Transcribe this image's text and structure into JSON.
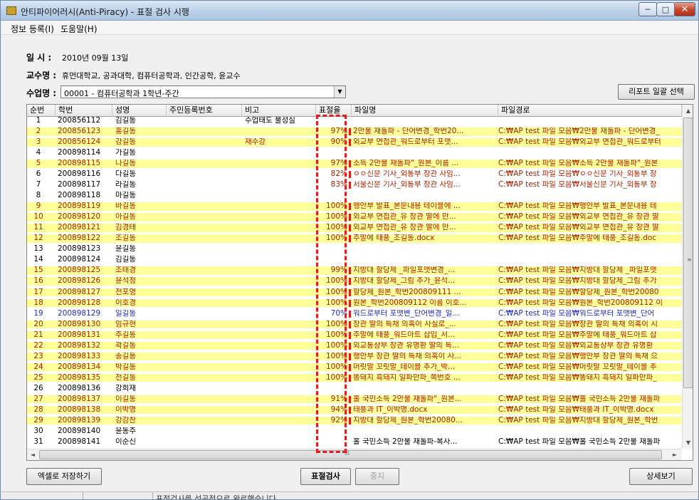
{
  "window": {
    "title": "안티파이어러시(Anti-Piracy) - 표절 검사 시행",
    "min": "─",
    "max": "□",
    "close": "✕"
  },
  "menu": [
    "정보 등록(I)",
    "도움말(H)"
  ],
  "info": {
    "date_label": "일  시 :",
    "date_value": "2010년 09월 13일",
    "prof_label": "교수명 :",
    "prof_value": "휴먼대학교, 공과대학, 컴퓨터공학과, 인간공학, 윤교수",
    "course_label": "수업명 :",
    "course_value": "00001 - 컴퓨터공학과 1학년-주간"
  },
  "buttons": {
    "report": "리포트 일괄 선택",
    "excel": "엑셀로 저장하기",
    "check": "표절검사",
    "stop": "중지",
    "detail": "상세보기"
  },
  "columns": [
    "순번",
    "학번",
    "성명",
    "주민등록번호",
    "비고",
    "표절율",
    "파일명",
    "파일경로"
  ],
  "rows": [
    {
      "no": "1",
      "id": "200856112",
      "name": "김길동",
      "note": "수업태도 불성실",
      "pct": "",
      "file": "",
      "path": "",
      "style": "normal"
    },
    {
      "no": "2",
      "id": "200856123",
      "name": "홍길동",
      "note": "",
      "pct": "97%",
      "file": "2만불 재돌파 - 단어변경_학번20...",
      "path": "C:₩AP test 파일 모음₩2만불 재돌파 - 단어변경_",
      "style": "hl"
    },
    {
      "no": "3",
      "id": "200856124",
      "name": "강길동",
      "note": "재수강",
      "pct": "90%",
      "file": "외교부 면접관_워드로부터 포맷...",
      "path": "C:₩AP test 파일 모음₩외교부 면접관_워드로부터",
      "style": "hl"
    },
    {
      "no": "4",
      "id": "200898114",
      "name": "가길동",
      "note": "",
      "pct": "",
      "file": "",
      "path": "",
      "style": "normal"
    },
    {
      "no": "5",
      "id": "200898115",
      "name": "나길동",
      "note": "",
      "pct": "97%",
      "file": "소득 2만불 재돌파\"_원본_이름 ...",
      "path": "C:₩AP test 파일 모음₩소득 2만불 재돌파\"_원본",
      "style": "hl"
    },
    {
      "no": "6",
      "id": "200898116",
      "name": "다길동",
      "note": "",
      "pct": "82%",
      "file": "ㅇㅇ신문 기사_외통부 장관 사임...",
      "path": "C:₩AP test 파일 모음₩ㅇㅇ신문 기사_외통부 장",
      "style": "normal-red"
    },
    {
      "no": "7",
      "id": "200898117",
      "name": "라길동",
      "note": "",
      "pct": "83%",
      "file": "서울신문 기사_외통부 장관 사임...",
      "path": "C:₩AP test 파일 모음₩서울신문 기사_외통부 장",
      "style": "normal-red"
    },
    {
      "no": "8",
      "id": "200898118",
      "name": "마길동",
      "note": "",
      "pct": "",
      "file": "",
      "path": "",
      "style": "normal"
    },
    {
      "no": "9",
      "id": "200898119",
      "name": "바길동",
      "note": "",
      "pct": "100%",
      "file": "행안부 발표_본문내용 테이블에 ...",
      "path": "C:₩AP test 파일 모음₩행안부 발표_본문내용 테",
      "style": "hl"
    },
    {
      "no": "10",
      "id": "200898120",
      "name": "아길동",
      "note": "",
      "pct": "100%",
      "file": "외교부 면접관_유 장관 딸에 만...",
      "path": "C:₩AP test 파일 모음₩외교부 면접관_유 장관 딸",
      "style": "hl"
    },
    {
      "no": "11",
      "id": "200898121",
      "name": "김경태",
      "note": "",
      "pct": "100%",
      "file": "외교부 면접관_유 장관 딸에 만...",
      "path": "C:₩AP test 파일 모음₩외교부 면접관_유 장관 딸",
      "style": "hl"
    },
    {
      "no": "12",
      "id": "200898122",
      "name": "조길동",
      "note": "",
      "pct": "100%",
      "file": "주말에 태풍_조길동.docx",
      "path": "C:₩AP test 파일 모음₩주말에 태풍_조길동.doc",
      "style": "hl"
    },
    {
      "no": "13",
      "id": "200898123",
      "name": "윤길동",
      "note": "",
      "pct": "",
      "file": "",
      "path": "",
      "style": "normal"
    },
    {
      "no": "14",
      "id": "200898124",
      "name": "김길동",
      "note": "",
      "pct": "",
      "file": "",
      "path": "",
      "style": "normal"
    },
    {
      "no": "15",
      "id": "200898125",
      "name": "조태경",
      "note": "",
      "pct": "99%",
      "file": "지방대 할당제 _파일포맷변경_...",
      "path": "C:₩AP test 파일 모음₩지방대 할당제 _파일포맷",
      "style": "hl"
    },
    {
      "no": "16",
      "id": "200898126",
      "name": "윤석정",
      "note": "",
      "pct": "100%",
      "file": "지방대 할당제_그림 추가_윤석...",
      "path": "C:₩AP test 파일 모음₩지방대 할당제_그림 추가",
      "style": "hl"
    },
    {
      "no": "17",
      "id": "200898127",
      "name": "전포영",
      "note": "",
      "pct": "100%",
      "file": "할당제_원본_학번200809111 ...",
      "path": "C:₩AP test 파일 모음₩할당제_원본_학번20080",
      "style": "hl"
    },
    {
      "no": "18",
      "id": "200898128",
      "name": "이호경",
      "note": "",
      "pct": "100%",
      "file": "원본_학번200809112 이름 이호...",
      "path": "C:₩AP test 파일 모음₩원본_학번200809112 이",
      "style": "hl"
    },
    {
      "no": "19",
      "id": "200898129",
      "name": "일길동",
      "note": "",
      "pct": "70%",
      "file": "워드로부터 포맷변_단어변경_일...",
      "path": "C:₩AP test 파일 모음₩워드로부터 포맷변_단어",
      "style": "blue"
    },
    {
      "no": "20",
      "id": "200898130",
      "name": "임규현",
      "note": "",
      "pct": "100%",
      "file": "장관 딸의 특채 의혹이 사실로_...",
      "path": "C:₩AP test 파일 모음₩장관 딸의 특채 의혹이 시",
      "style": "hl"
    },
    {
      "no": "21",
      "id": "200898131",
      "name": "주길동",
      "note": "",
      "pct": "100%",
      "file": "주말에 태풍_워드아트 삽입_서...",
      "path": "C:₩AP test 파일 모음₩주말에 태풍_워드아트 삽",
      "style": "hl"
    },
    {
      "no": "22",
      "id": "200898132",
      "name": "곽길동",
      "note": "",
      "pct": "100%",
      "file": "외교통상부 장관 유명환 딸의 특...",
      "path": "C:₩AP test 파일 모음₩외교통상부 장관 유명환",
      "style": "hl"
    },
    {
      "no": "23",
      "id": "200898133",
      "name": "송길동",
      "note": "",
      "pct": "100%",
      "file": "행안부 장관 딸의 특채 의혹이 사...",
      "path": "C:₩AP test 파일 모음₩행안부 장관 딸의 특채 으",
      "style": "hl"
    },
    {
      "no": "24",
      "id": "200898134",
      "name": "박길동",
      "note": "",
      "pct": "100%",
      "file": "머릿말 꼬릿말_테이블 추가_박...",
      "path": "C:₩AP test 파일 모음₩머릿말 꼬릿말_테이블 추",
      "style": "hl"
    },
    {
      "no": "25",
      "id": "200898135",
      "name": "전길동",
      "note": "",
      "pct": "100%",
      "file": "똥돼지 흑돼지 일파만파_쪽번호 ...",
      "path": "C:₩AP test 파일 모음₩똥돼지 흑돼지 일파만파_",
      "style": "hl"
    },
    {
      "no": "26",
      "id": "200898136",
      "name": "강희재",
      "note": "",
      "pct": "",
      "file": "",
      "path": "",
      "style": "normal"
    },
    {
      "no": "27",
      "id": "200898137",
      "name": "이길동",
      "note": "",
      "pct": "91%",
      "file": "홀 국민소득 2만불 재돌파\"_원본...",
      "path": "C:₩AP test 파일 모음₩홀 국민소득 2만불 재돌파",
      "style": "hl"
    },
    {
      "no": "28",
      "id": "200898138",
      "name": "이박명",
      "note": "",
      "pct": "94%",
      "file": "태풍과 IT_이박명.docx",
      "path": "C:₩AP test 파일 모음₩태풍과 IT_이박명.docx",
      "style": "hl"
    },
    {
      "no": "29",
      "id": "200898139",
      "name": "강감찬",
      "note": "",
      "pct": "92%",
      "file": "지방대 할당제_원본_학번20080...",
      "path": "C:₩AP test 파일 모음₩지방대 할당제_원본_학번",
      "style": "hl"
    },
    {
      "no": "30",
      "id": "200898140",
      "name": "윤동주",
      "note": "",
      "pct": "",
      "file": "",
      "path": "",
      "style": "normal"
    },
    {
      "no": "31",
      "id": "200898141",
      "name": "이순신",
      "note": "",
      "pct": "",
      "file": "홀 국민소득 2만불 재돌파-복사...",
      "path": "C:₩AP test 파일 모음₩홀 국민소득 2만불 재돌파",
      "style": "normal"
    }
  ],
  "scroll": {
    "up": "▲",
    "down": "▼",
    "left": "◄",
    "right": "►",
    "grip_v": "≡",
    "grip_h": "III"
  },
  "status": {
    "text": "표절검사를 성공적으로 완료했습니다."
  },
  "colors": {
    "highlight_row": "#ffff99",
    "highlight_text": "#b02000",
    "blue_row_text": "#1d2ad0",
    "marker": "#e02020"
  },
  "icons": {
    "app": "app-icon",
    "combo_arrow": "chevron-down-icon"
  }
}
